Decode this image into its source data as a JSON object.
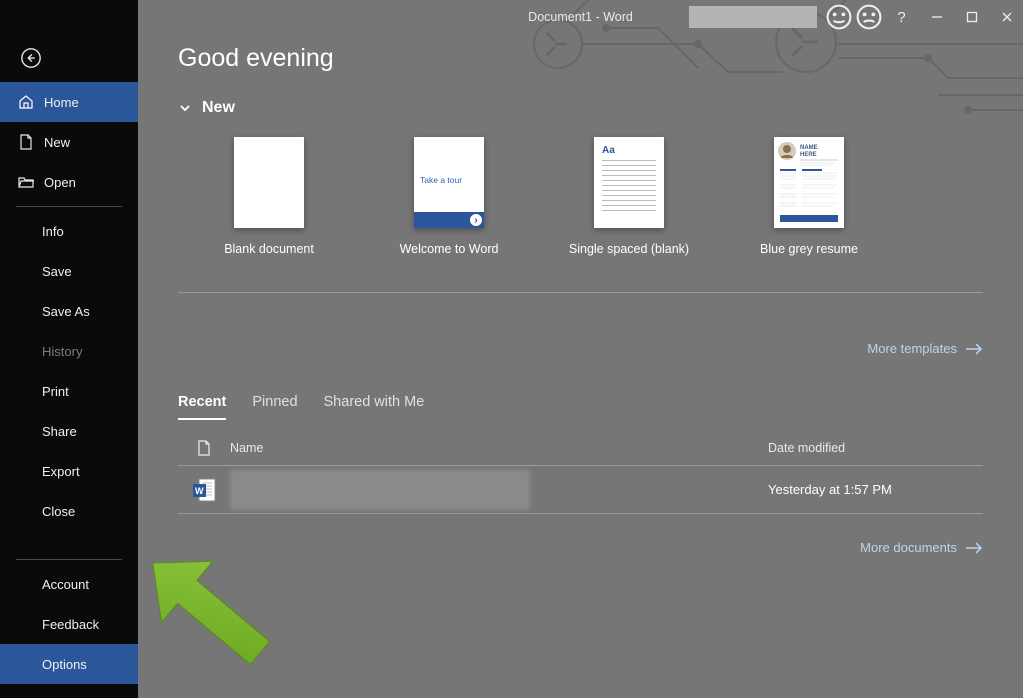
{
  "window": {
    "title": "Document1  -  Word"
  },
  "sidebar": {
    "home": "Home",
    "new": "New",
    "open": "Open",
    "info": "Info",
    "save": "Save",
    "saveAs": "Save As",
    "history": "History",
    "print": "Print",
    "share": "Share",
    "export": "Export",
    "close": "Close",
    "account": "Account",
    "feedback": "Feedback",
    "options": "Options"
  },
  "main": {
    "greeting": "Good evening",
    "newSection": "New",
    "templates": [
      {
        "label": "Blank document"
      },
      {
        "label": "Welcome to Word",
        "tour": "Take a tour"
      },
      {
        "label": "Single spaced (blank)",
        "aa": "Aa"
      },
      {
        "label": "Blue grey resume",
        "name": "NAME HERE"
      }
    ],
    "moreTemplates": "More templates",
    "tabs": {
      "recent": "Recent",
      "pinned": "Pinned",
      "shared": "Shared with Me"
    },
    "columns": {
      "name": "Name",
      "date": "Date modified"
    },
    "rows": [
      {
        "date": "Yesterday at 1:57 PM"
      }
    ],
    "moreDocuments": "More documents"
  }
}
